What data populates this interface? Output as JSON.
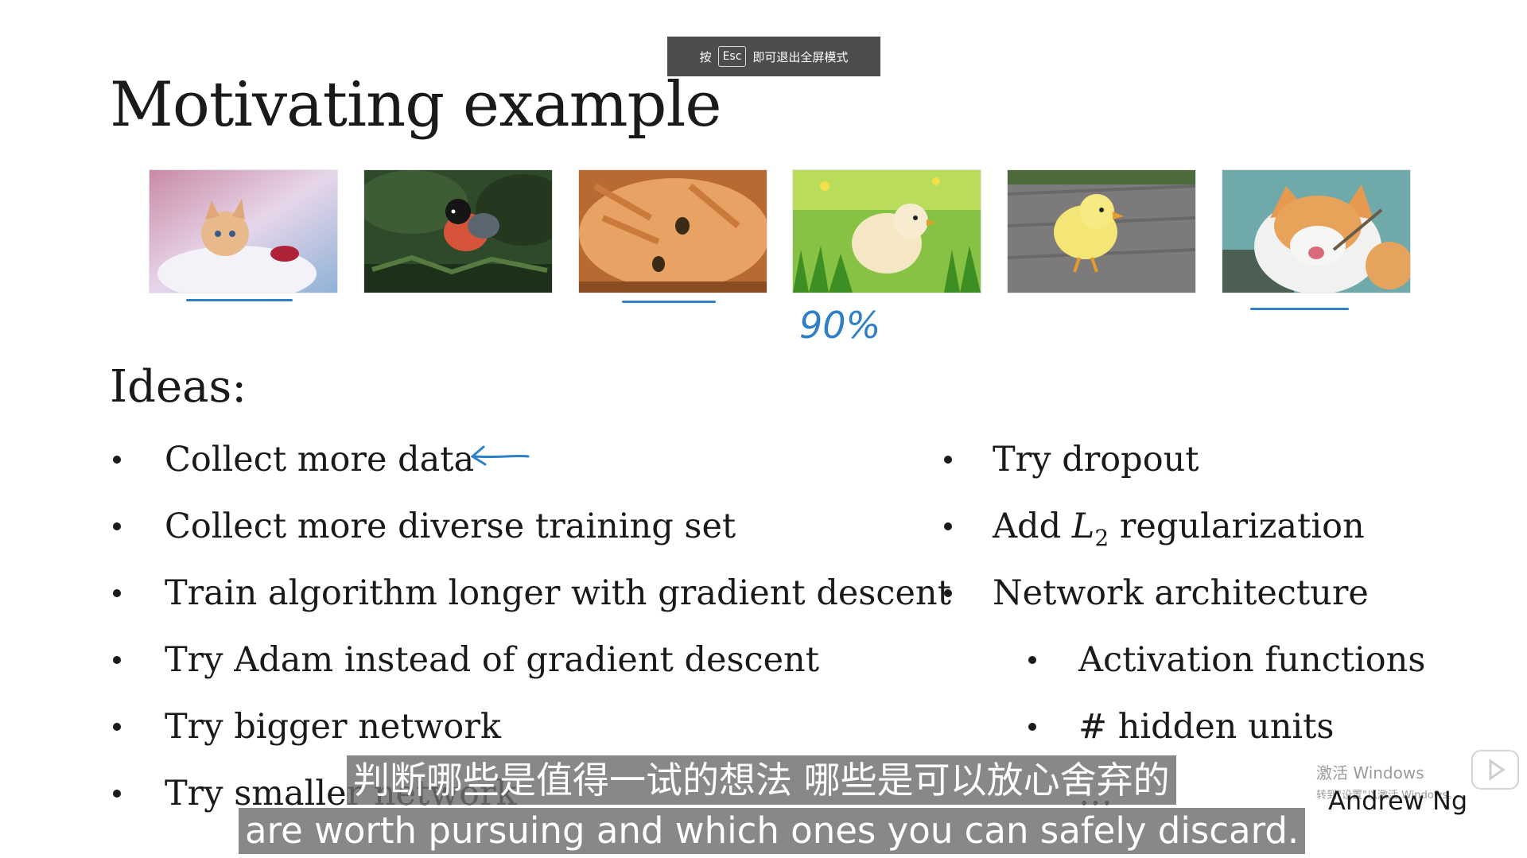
{
  "esc_hint": {
    "prefix": "按",
    "key": "Esc",
    "suffix": "即可退出全屏模式"
  },
  "slide": {
    "title": "Motivating example",
    "images": [
      {
        "subject": "kitten-image",
        "underlined": true
      },
      {
        "subject": "bird-image",
        "underlined": false
      },
      {
        "subject": "cat-image",
        "underlined": true
      },
      {
        "subject": "chick-image",
        "underlined": false
      },
      {
        "subject": "chick-image",
        "underlined": false
      },
      {
        "subject": "cat-image",
        "underlined": true
      }
    ],
    "handwritten_note": "90%",
    "ideas_heading": "Ideas:",
    "left_ideas": [
      "Collect more data",
      "Collect more diverse training set",
      "Train algorithm longer with gradient descent",
      "Try Adam instead of gradient descent",
      "Try bigger network",
      "Try smaller network"
    ],
    "right_ideas": {
      "dropout": "Try dropout",
      "l2_prefix": "Add ",
      "l2_symbol": "L",
      "l2_subscript": "2",
      "l2_suffix": " regularization",
      "architecture": "Network architecture",
      "activation": "Activation functions",
      "hidden_units": "# hidden units",
      "ellipsis": "…"
    },
    "author": "Andrew Ng"
  },
  "watermark": {
    "line1": "激活 Windows",
    "line2": "转到\"设置\"以激活 Windows。"
  },
  "subtitles": {
    "chinese": "判断哪些是值得一试的想法 哪些是可以放心舍弃的",
    "english": "are worth pursuing and which ones you can safely discard."
  },
  "colors": {
    "ink_blue": "#2f7fc7",
    "subtitle_bg": "#6e6e6e",
    "banner_bg": "#4d4d4d"
  }
}
